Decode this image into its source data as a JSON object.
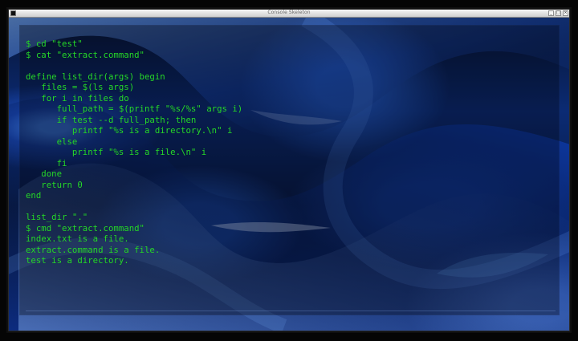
{
  "window": {
    "title": "Console Skeleton",
    "controls": {
      "minimize": "_",
      "maximize": "□",
      "close": "×"
    }
  },
  "terminal": {
    "lines": [
      "$ cd \"test\"",
      "$ cat \"extract.command\"",
      "",
      "define list_dir(args) begin",
      "   files = $(ls args)",
      "   for i in files do",
      "      full_path = $(printf \"%s/%s\" args i)",
      "      if test --d full_path; then",
      "         printf \"%s is a directory.\\n\" i",
      "      else",
      "         printf \"%s is a file.\\n\" i",
      "      fi",
      "   done",
      "   return 0",
      "end",
      "",
      "list_dir \".\"",
      "$ cmd \"extract.command\"",
      "index.txt is a file.",
      "extract.command is a file.",
      "test is a directory."
    ],
    "prompt": "$ "
  },
  "colors": {
    "terminal_text": "#26d92c",
    "window_background": "#0b2b74",
    "accent": "#4bff4b"
  },
  "icons": {
    "app": "terminal-icon",
    "minimize": "minimize-icon",
    "maximize": "maximize-icon",
    "close": "close-icon"
  }
}
